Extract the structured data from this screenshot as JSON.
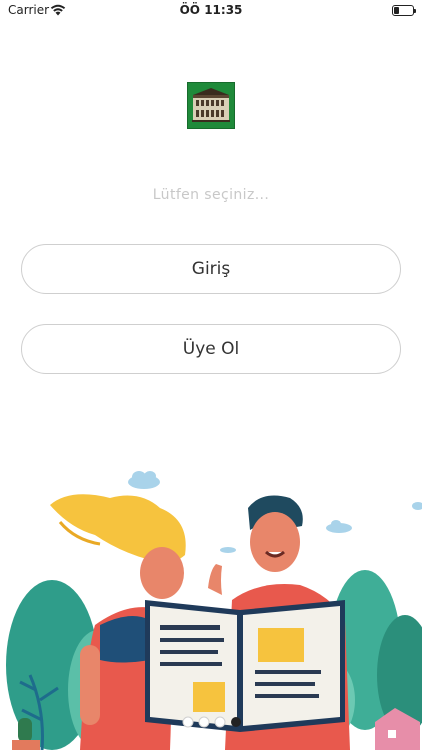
{
  "status_bar": {
    "carrier": "Carrier",
    "time": "ÖÖ 11:35",
    "battery_level": 0.25
  },
  "logo": {
    "icon": "building-logo-icon",
    "color": "#1f8a3a"
  },
  "prompt": "Lütfen seçiniz...",
  "buttons": {
    "login_label": "Giriş",
    "signup_label": "Üye Ol"
  },
  "illustration": {
    "icon": "people-reading-newspaper-illustration"
  }
}
